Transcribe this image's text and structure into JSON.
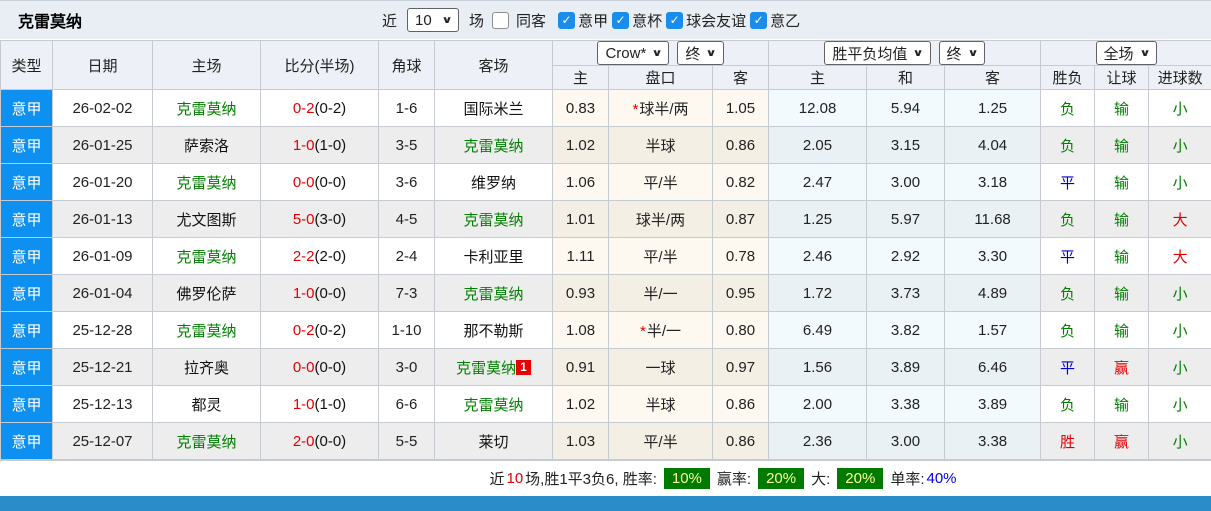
{
  "colors": {
    "league_cell": "#0e90f0",
    "team_highlight": "#008000",
    "score_red": "#e60000",
    "draw_blue": "#0000cc",
    "badge_green_bg": "#007a00",
    "badge_text": "#ffff99",
    "bottom_bar": "#2a8dca",
    "toolbar_bg": "#e9eef5"
  },
  "toolbar": {
    "title": "克雷莫纳",
    "near_label": "近",
    "near_value": "10",
    "unit_label": "场",
    "checkboxes": [
      {
        "label": "同客",
        "checked": false
      },
      {
        "label": "意甲",
        "checked": true
      },
      {
        "label": "意杯",
        "checked": true
      },
      {
        "label": "球会友谊",
        "checked": true
      },
      {
        "label": "意乙",
        "checked": true
      }
    ]
  },
  "table": {
    "left_headers": [
      "类型",
      "日期",
      "主场",
      "比分(半场)",
      "角球",
      "客场"
    ],
    "selects": {
      "odds_company": "Crow*",
      "odds_state": "终",
      "avg_label": "胜平负均值",
      "avg_state": "终",
      "scope": "全场"
    },
    "sub_headers": [
      "主",
      "盘口",
      "客",
      "主",
      "和",
      "客",
      "胜负",
      "让球",
      "进球数"
    ],
    "rows": [
      {
        "league": "意甲",
        "date": "26-02-02",
        "home": "克雷莫纳",
        "home_color": "green",
        "score": "0-2",
        "half": "(0-2)",
        "corners": "1-6",
        "away": "国际米兰",
        "away_color": "black",
        "away_badge": "",
        "odds_home": "0.83",
        "handicap": "球半/两",
        "handicap_star": true,
        "odds_away": "1.05",
        "avg_home": "12.08",
        "avg_draw": "5.94",
        "avg_away": "1.25",
        "wdl": "负",
        "wdl_color": "green",
        "let_result": "输",
        "let_color": "green",
        "goals": "小",
        "goals_color": "green"
      },
      {
        "league": "意甲",
        "date": "26-01-25",
        "home": "萨索洛",
        "home_color": "black",
        "score": "1-0",
        "half": "(1-0)",
        "corners": "3-5",
        "away": "克雷莫纳",
        "away_color": "green",
        "away_badge": "",
        "odds_home": "1.02",
        "handicap": "半球",
        "handicap_star": false,
        "odds_away": "0.86",
        "avg_home": "2.05",
        "avg_draw": "3.15",
        "avg_away": "4.04",
        "wdl": "负",
        "wdl_color": "green",
        "let_result": "输",
        "let_color": "green",
        "goals": "小",
        "goals_color": "green"
      },
      {
        "league": "意甲",
        "date": "26-01-20",
        "home": "克雷莫纳",
        "home_color": "green",
        "score": "0-0",
        "half": "(0-0)",
        "corners": "3-6",
        "away": "维罗纳",
        "away_color": "black",
        "away_badge": "",
        "odds_home": "1.06",
        "handicap": "平/半",
        "handicap_star": false,
        "odds_away": "0.82",
        "avg_home": "2.47",
        "avg_draw": "3.00",
        "avg_away": "3.18",
        "wdl": "平",
        "wdl_color": "blue",
        "let_result": "输",
        "let_color": "green",
        "goals": "小",
        "goals_color": "green"
      },
      {
        "league": "意甲",
        "date": "26-01-13",
        "home": "尤文图斯",
        "home_color": "black",
        "score": "5-0",
        "half": "(3-0)",
        "corners": "4-5",
        "away": "克雷莫纳",
        "away_color": "green",
        "away_badge": "",
        "odds_home": "1.01",
        "handicap": "球半/两",
        "handicap_star": false,
        "odds_away": "0.87",
        "avg_home": "1.25",
        "avg_draw": "5.97",
        "avg_away": "11.68",
        "wdl": "负",
        "wdl_color": "green",
        "let_result": "输",
        "let_color": "green",
        "goals": "大",
        "goals_color": "red"
      },
      {
        "league": "意甲",
        "date": "26-01-09",
        "home": "克雷莫纳",
        "home_color": "green",
        "score": "2-2",
        "half": "(2-0)",
        "corners": "2-4",
        "away": "卡利亚里",
        "away_color": "black",
        "away_badge": "",
        "odds_home": "1.11",
        "handicap": "平/半",
        "handicap_star": false,
        "odds_away": "0.78",
        "avg_home": "2.46",
        "avg_draw": "2.92",
        "avg_away": "3.30",
        "wdl": "平",
        "wdl_color": "blue",
        "let_result": "输",
        "let_color": "green",
        "goals": "大",
        "goals_color": "red"
      },
      {
        "league": "意甲",
        "date": "26-01-04",
        "home": "佛罗伦萨",
        "home_color": "black",
        "score": "1-0",
        "half": "(0-0)",
        "corners": "7-3",
        "away": "克雷莫纳",
        "away_color": "green",
        "away_badge": "",
        "odds_home": "0.93",
        "handicap": "半/一",
        "handicap_star": false,
        "odds_away": "0.95",
        "avg_home": "1.72",
        "avg_draw": "3.73",
        "avg_away": "4.89",
        "wdl": "负",
        "wdl_color": "green",
        "let_result": "输",
        "let_color": "green",
        "goals": "小",
        "goals_color": "green"
      },
      {
        "league": "意甲",
        "date": "25-12-28",
        "home": "克雷莫纳",
        "home_color": "green",
        "score": "0-2",
        "half": "(0-2)",
        "corners": "1-10",
        "away": "那不勒斯",
        "away_color": "black",
        "away_badge": "",
        "odds_home": "1.08",
        "handicap": "半/一",
        "handicap_star": true,
        "odds_away": "0.80",
        "avg_home": "6.49",
        "avg_draw": "3.82",
        "avg_away": "1.57",
        "wdl": "负",
        "wdl_color": "green",
        "let_result": "输",
        "let_color": "green",
        "goals": "小",
        "goals_color": "green"
      },
      {
        "league": "意甲",
        "date": "25-12-21",
        "home": "拉齐奥",
        "home_color": "black",
        "score": "0-0",
        "half": "(0-0)",
        "corners": "3-0",
        "away": "克雷莫纳",
        "away_color": "green",
        "away_badge": "1",
        "odds_home": "0.91",
        "handicap": "一球",
        "handicap_star": false,
        "odds_away": "0.97",
        "avg_home": "1.56",
        "avg_draw": "3.89",
        "avg_away": "6.46",
        "wdl": "平",
        "wdl_color": "blue",
        "let_result": "赢",
        "let_color": "red",
        "goals": "小",
        "goals_color": "green"
      },
      {
        "league": "意甲",
        "date": "25-12-13",
        "home": "都灵",
        "home_color": "black",
        "score": "1-0",
        "half": "(1-0)",
        "corners": "6-6",
        "away": "克雷莫纳",
        "away_color": "green",
        "away_badge": "",
        "odds_home": "1.02",
        "handicap": "半球",
        "handicap_star": false,
        "odds_away": "0.86",
        "avg_home": "2.00",
        "avg_draw": "3.38",
        "avg_away": "3.89",
        "wdl": "负",
        "wdl_color": "green",
        "let_result": "输",
        "let_color": "green",
        "goals": "小",
        "goals_color": "green"
      },
      {
        "league": "意甲",
        "date": "25-12-07",
        "home": "克雷莫纳",
        "home_color": "green",
        "score": "2-0",
        "half": "(0-0)",
        "corners": "5-5",
        "away": "莱切",
        "away_color": "black",
        "away_badge": "",
        "odds_home": "1.03",
        "handicap": "平/半",
        "handicap_star": false,
        "odds_away": "0.86",
        "avg_home": "2.36",
        "avg_draw": "3.00",
        "avg_away": "3.38",
        "wdl": "胜",
        "wdl_color": "red",
        "let_result": "赢",
        "let_color": "red",
        "goals": "小",
        "goals_color": "green"
      }
    ]
  },
  "summary": {
    "prefix": "近",
    "count": "10",
    "stats_text": "场,胜1平3负6, 胜率:",
    "win_rate": "10%",
    "odds_win_label": "赢率:",
    "odds_win_rate": "20%",
    "big_label": "大:",
    "big_rate": "20%",
    "single_label": "单率:",
    "single_rate": "40%"
  }
}
